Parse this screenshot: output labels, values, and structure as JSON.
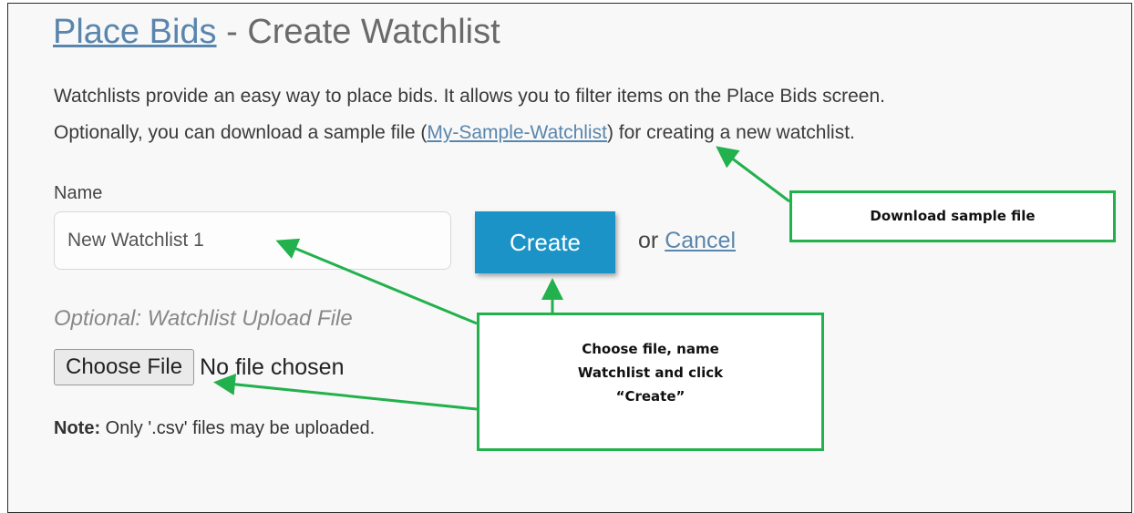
{
  "header": {
    "title_link": "Place Bids",
    "title_rest": " - Create Watchlist"
  },
  "intro": {
    "line1": "Watchlists provide an easy way to place bids. It allows you to filter items on the Place Bids screen.",
    "line2_prefix": "Optionally, you can download a sample file (",
    "sample_link": "My-Sample-Watchlist",
    "line2_suffix": ") for creating a new watchlist."
  },
  "form": {
    "name_label": "Name",
    "name_value": "New Watchlist 1",
    "create_label": "Create",
    "or_text": "or ",
    "cancel_label": "Cancel",
    "optional_label": "Optional: Watchlist Upload File",
    "choose_file_label": "Choose File",
    "no_file_text": "No file chosen",
    "note_bold": "Note:",
    "note_text": " Only '.csv' files may be uploaded."
  },
  "annotations": {
    "download_callout": "Download sample file",
    "create_callout": [
      "Choose file, name",
      "Watchlist and click",
      "“Create”"
    ],
    "callout_border_color": "#22b14c",
    "arrow_color": "#22b14c"
  },
  "colors": {
    "link": "#5a86ad",
    "create_button": "#1c93c6"
  }
}
